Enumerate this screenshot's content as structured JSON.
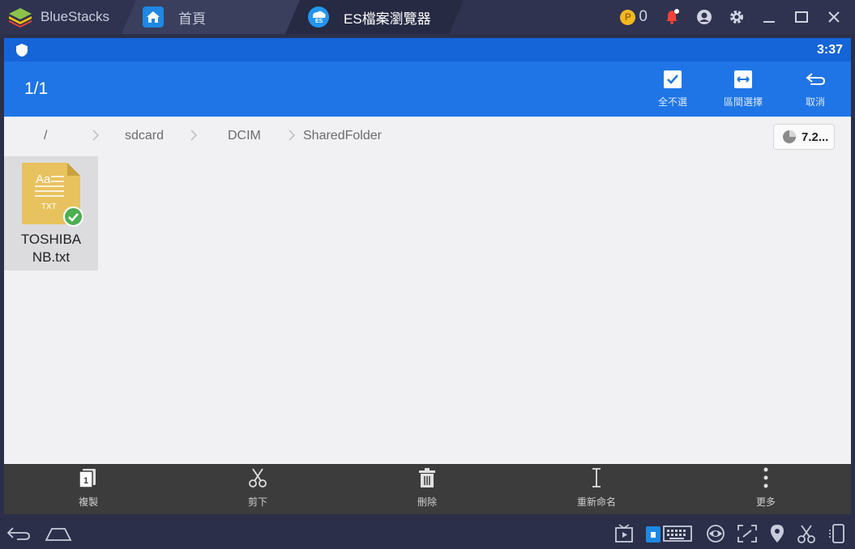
{
  "window": {
    "app_name": "BlueStacks",
    "tabs": [
      {
        "label": "首頁",
        "icon": "home-icon"
      },
      {
        "label": "ES檔案瀏覽器",
        "icon": "es-file-explorer-icon"
      }
    ],
    "coins": "0",
    "controls": [
      "bell-icon",
      "account-icon",
      "settings-icon",
      "minimize-icon",
      "maximize-icon",
      "close-icon"
    ]
  },
  "statusbar": {
    "time": "3:37"
  },
  "actionbar": {
    "selection_count": "1/1",
    "actions": [
      {
        "label": "全不選",
        "icon": "checkbox-icon"
      },
      {
        "label": "區間選擇",
        "icon": "range-select-icon"
      },
      {
        "label": "取消",
        "icon": "undo-icon"
      }
    ]
  },
  "breadcrumb": {
    "items": [
      "/",
      "sdcard",
      "DCIM",
      "SharedFolder"
    ],
    "storage_label": "7.2..."
  },
  "files": [
    {
      "name": "TOSHIBANB.txt",
      "name_line1": "TOSHIBA",
      "name_line2": "NB.txt",
      "type_label": "TXT",
      "icon_text": "Aa",
      "selected": true
    }
  ],
  "bottom_actions": [
    {
      "label": "複製",
      "icon": "copy-icon"
    },
    {
      "label": "剪下",
      "icon": "cut-icon"
    },
    {
      "label": "刪除",
      "icon": "delete-icon"
    },
    {
      "label": "重新命名",
      "icon": "rename-icon"
    },
    {
      "label": "更多",
      "icon": "more-icon"
    }
  ],
  "colors": {
    "status_bar": "#1565d8",
    "action_bar": "#1f75e6",
    "file_icon": "#e8c25e",
    "check_badge": "#4caf50"
  }
}
